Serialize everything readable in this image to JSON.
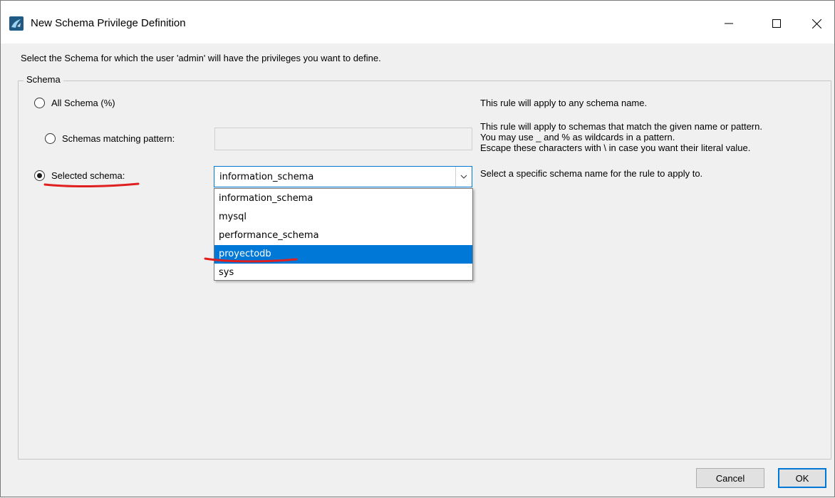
{
  "window": {
    "title": "New Schema Privilege Definition"
  },
  "instruction": "Select the Schema for which the user 'admin' will have the privileges you want to define.",
  "schema_group": {
    "label": "Schema",
    "options": [
      {
        "label": "All Schema (%)",
        "checked": false,
        "description": [
          "This rule will apply to any schema name."
        ]
      },
      {
        "label": "Schemas matching pattern:",
        "checked": false,
        "description": [
          "This rule will apply to schemas that match the given name or pattern.",
          "You may use _ and % as wildcards in a pattern.",
          "Escape these characters with \\ in case you want their literal value."
        ]
      },
      {
        "label": "Selected schema:",
        "checked": true,
        "description": [
          "Select a specific schema name for the rule to apply to."
        ]
      }
    ],
    "pattern_value": "",
    "selected_schema": "information_schema",
    "dropdown_items": [
      "information_schema",
      "mysql",
      "performance_schema",
      "proyectodb",
      "sys"
    ],
    "highlighted_item": "proyectodb"
  },
  "buttons": {
    "cancel": "Cancel",
    "ok": "OK"
  },
  "colors": {
    "accent": "#0078d7",
    "annotation": "#e02020"
  },
  "icons": [
    "mysql-workbench-icon",
    "minimize-icon",
    "maximize-icon",
    "close-icon",
    "chevron-down-icon"
  ]
}
